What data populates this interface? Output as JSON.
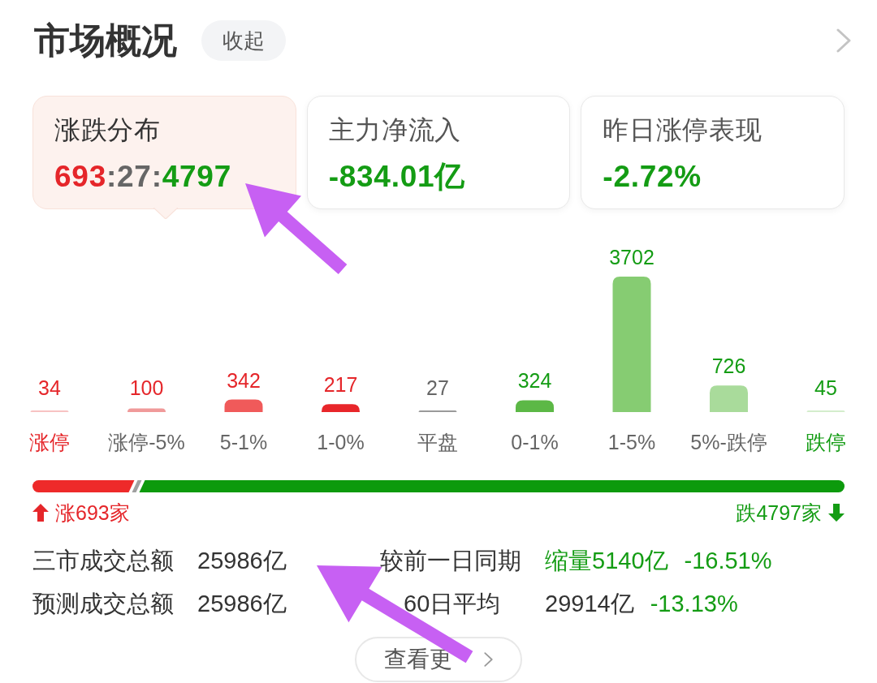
{
  "header": {
    "title": "市场概况",
    "collapse_button": "收起"
  },
  "cards": [
    {
      "title": "涨跌分布",
      "selected": true,
      "value_parts": [
        {
          "text": "693",
          "color": "#e5262a"
        },
        {
          "text": ":",
          "color": "#666666"
        },
        {
          "text": "27",
          "color": "#666666"
        },
        {
          "text": ":",
          "color": "#666666"
        },
        {
          "text": "4797",
          "color": "#149c14"
        }
      ]
    },
    {
      "title": "主力净流入",
      "selected": false,
      "value_parts": [
        {
          "text": "-834.01亿",
          "color": "#149c14"
        }
      ]
    },
    {
      "title": "昨日涨停表现",
      "selected": false,
      "value_parts": [
        {
          "text": "-2.72%",
          "color": "#149c14"
        }
      ]
    }
  ],
  "distribution": {
    "chart_data": {
      "type": "bar",
      "categories": [
        "涨停",
        "涨停-5%",
        "5-1%",
        "1-0%",
        "平盘",
        "0-1%",
        "1-5%",
        "5%-跌停",
        "跌停"
      ],
      "values": [
        34,
        100,
        342,
        217,
        27,
        324,
        3702,
        726,
        45
      ],
      "data_labels": true
    },
    "bars": [
      {
        "kind": "rise",
        "color": "#f7c3c3",
        "emphasized": true
      },
      {
        "kind": "rise",
        "color": "#f09a9a",
        "emphasized": false
      },
      {
        "kind": "rise",
        "color": "#f05a5a",
        "emphasized": false
      },
      {
        "kind": "rise",
        "color": "#e8262a",
        "emphasized": false
      },
      {
        "kind": "flat",
        "color": "#9a9a9a",
        "emphasized": false
      },
      {
        "kind": "fall",
        "color": "#5cb846",
        "emphasized": false
      },
      {
        "kind": "fall",
        "color": "#86cc72",
        "emphasized": false
      },
      {
        "kind": "fall",
        "color": "#a9db9b",
        "emphasized": false
      },
      {
        "kind": "fall",
        "color": "#d4edcc",
        "emphasized": true
      }
    ]
  },
  "breadth": {
    "segments": [
      {
        "kind": "up",
        "level": 0.126
      },
      {
        "kind": "flat",
        "level": 0.005
      },
      {
        "kind": "down",
        "level": 0.869
      }
    ],
    "up_count": "涨693家",
    "down_count": "跌4797家"
  },
  "stats": [
    {
      "label": "三市成交总额",
      "value": "25986亿",
      "compare_label": "较前一日同期",
      "compare": [
        {
          "text": "缩量5140亿",
          "color": "#149c14"
        },
        {
          "text": "-16.51%",
          "color": "#149c14"
        }
      ]
    },
    {
      "label": "预测成交总额",
      "value": "25986亿",
      "compare_label": "60日平均",
      "compare": [
        {
          "text": "29914亿",
          "color": "#333333"
        },
        {
          "text": "-13.13%",
          "color": "#149c14"
        }
      ]
    }
  ],
  "more_button": "查看更"
}
